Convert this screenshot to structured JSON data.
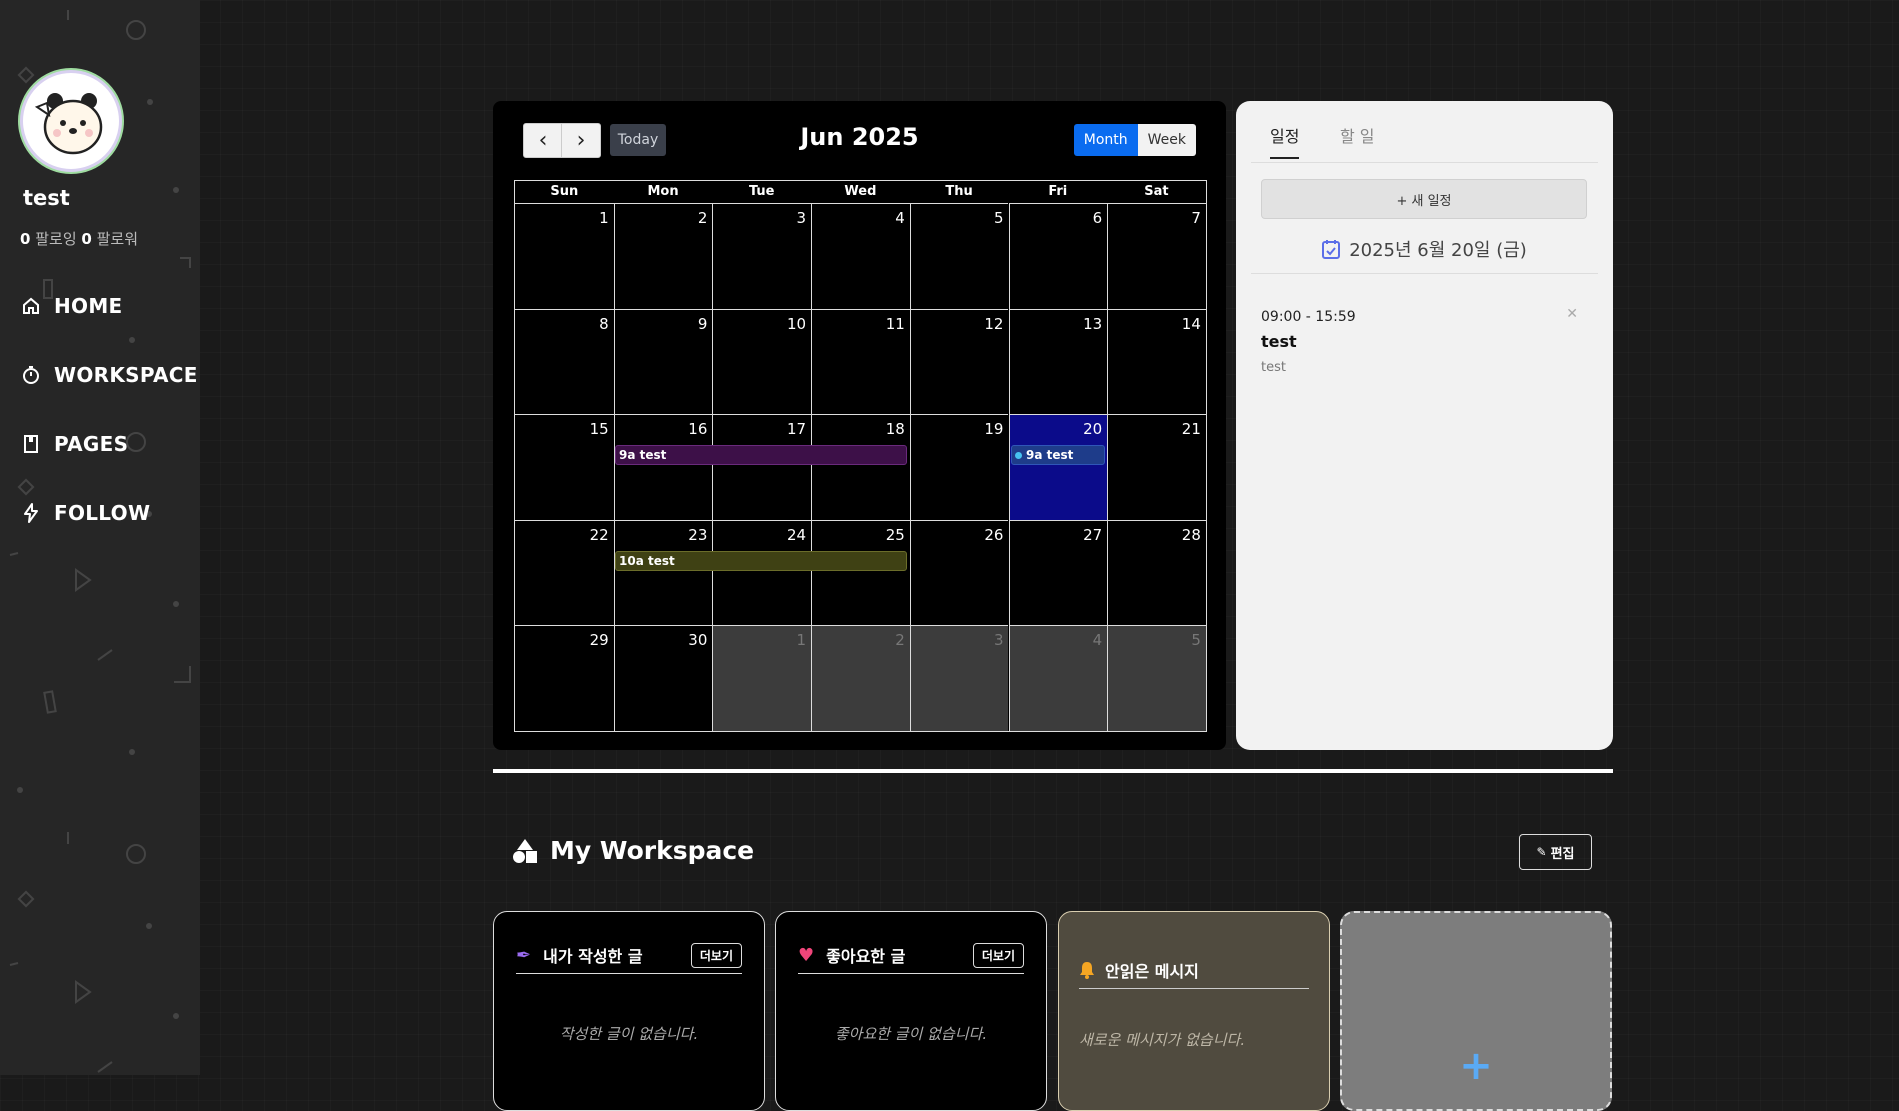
{
  "sidebar": {
    "username": "test",
    "following_count": "0",
    "following_label": "팔로잉",
    "follower_count": "0",
    "follower_label": "팔로워",
    "nav": [
      {
        "label": "HOME",
        "icon": "home-icon"
      },
      {
        "label": "WORKSPACE",
        "icon": "stopwatch-icon"
      },
      {
        "label": "PAGES",
        "icon": "book-icon"
      },
      {
        "label": "FOLLOW",
        "icon": "lightning-icon"
      }
    ]
  },
  "calendar": {
    "title": "Jun 2025",
    "prev_symbol": "‹",
    "next_symbol": "›",
    "today_label": "Today",
    "month_label": "Month",
    "week_label": "Week",
    "days_of_week": [
      "Sun",
      "Mon",
      "Tue",
      "Wed",
      "Thu",
      "Fri",
      "Sat"
    ],
    "weeks": [
      [
        "1",
        "2",
        "3",
        "4",
        "5",
        "6",
        "7"
      ],
      [
        "8",
        "9",
        "10",
        "11",
        "12",
        "13",
        "14"
      ],
      [
        "15",
        "16",
        "17",
        "18",
        "19",
        "20",
        "21"
      ],
      [
        "22",
        "23",
        "24",
        "25",
        "26",
        "27",
        "28"
      ],
      [
        "29",
        "30",
        "1",
        "2",
        "3",
        "4",
        "5"
      ]
    ],
    "events": [
      {
        "time": "9a",
        "title": "test"
      },
      {
        "time": "9a",
        "title": "test"
      },
      {
        "time": "10a",
        "title": "test"
      }
    ]
  },
  "schedule": {
    "tab_schedule": "일정",
    "tab_todo": "할 일",
    "new_button": "+ 새 일정",
    "selected_date": "2025년 6월 20일 (금)",
    "items": [
      {
        "time": "09:00 - 15:59",
        "title": "test",
        "description": "test"
      }
    ]
  },
  "workspace": {
    "title": "My Workspace",
    "edit_label": "편집",
    "cards": [
      {
        "title": "내가 작성한 글",
        "more_label": "더보기",
        "empty": "작성한 글이 없습니다."
      },
      {
        "title": "좋아요한 글",
        "more_label": "더보기",
        "empty": "좋아요한 글이 없습니다."
      },
      {
        "title": "안읽은 메시지",
        "empty": "새로운 메시지가 없습니다."
      }
    ],
    "add_symbol": "+"
  },
  "colors": {
    "accent_blue": "#0a6cf0",
    "event_purple": "#3d1048",
    "event_blue": "#1e3c8a",
    "event_olive": "#3f4114",
    "today_cell": "#0b0b8a"
  }
}
